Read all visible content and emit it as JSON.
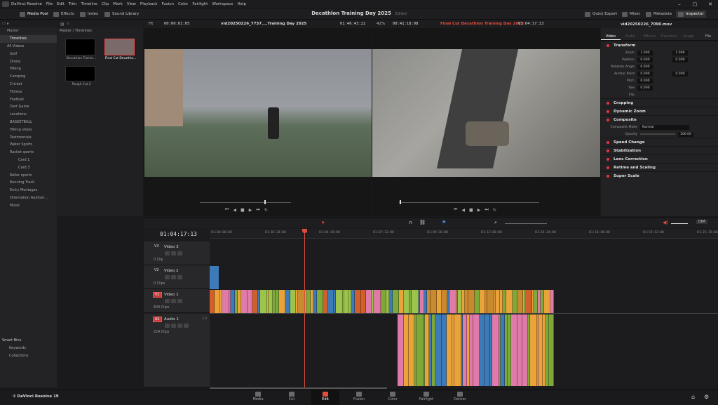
{
  "app": {
    "menu": [
      "DaVinci Resolve",
      "File",
      "Edit",
      "Trim",
      "Timeline",
      "Clip",
      "Mark",
      "View",
      "Playback",
      "Fusion",
      "Color",
      "Fairlight",
      "Workspace",
      "Help"
    ],
    "project_title": "Decathlon Training Day 2025",
    "edited_label": "Edited"
  },
  "toolbar": {
    "media_pool": "Media Pool",
    "effects": "Effects",
    "index": "Index",
    "sound_library": "Sound Library",
    "quick_export": "Quick Export",
    "mixer": "Mixer",
    "metadata": "Metadata",
    "inspector": "Inspector"
  },
  "bins": {
    "master": "Master",
    "items": [
      "Timelines",
      "All Videos",
      "Golf",
      "Drone",
      "Hiking",
      "Camping",
      "Cricket",
      "Fitness",
      "Football",
      "Dart Game",
      "Locations",
      "BASKETBALL",
      "Hiking shoes",
      "Testimonials",
      "Water Sports",
      "Racket sports",
      "Card 1",
      "Card 3",
      "Roller sports",
      "Running Track",
      "Entry Montages",
      "Orientation Auditori...",
      "Music"
    ],
    "smart_bins": "Smart Bins",
    "smart_items": [
      "Keywords",
      "Collections"
    ]
  },
  "pool": {
    "path": "Master / Timelines",
    "clips": [
      "Decathlon Trainin...",
      "Final Cut Decathlo...",
      "Rough Cut 2"
    ]
  },
  "source_viewer": {
    "fit": "Fit",
    "timecode_in": "00:00:01:05",
    "title": "vid20250226_7737....Training Day 2025",
    "timecode_out": "01:46:43:22"
  },
  "timeline_viewer": {
    "zoom": "42%",
    "timecode": "00:41:18:08",
    "title": "Final Cut Decathlon Training Day 2025",
    "timecode_out": "01:04:17:13"
  },
  "inspector": {
    "clip_name": "vid20250226_7090.mov",
    "tabs": [
      "Video",
      "Audio",
      "Effects",
      "Transition",
      "Image",
      "File"
    ],
    "transform": "Transform",
    "params": [
      {
        "label": "Zoom",
        "x": "1.000",
        "y": "1.000"
      },
      {
        "label": "Position",
        "x": "0.000",
        "y": "0.000"
      },
      {
        "label": "Rotation Angle",
        "x": "0.000",
        "y": ""
      },
      {
        "label": "Anchor Point",
        "x": "0.000",
        "y": "0.000"
      },
      {
        "label": "Pitch",
        "x": "0.000",
        "y": ""
      },
      {
        "label": "Yaw",
        "x": "0.000",
        "y": ""
      },
      {
        "label": "Flip",
        "x": "",
        "y": ""
      }
    ],
    "sections": [
      "Cropping",
      "Dynamic Zoom",
      "Composite"
    ],
    "composite_mode_label": "Composite Mode",
    "composite_mode": "Normal",
    "opacity_label": "Opacity",
    "opacity": "100.00",
    "more_sections": [
      "Speed Change",
      "Stabilization",
      "Lens Correction",
      "Retime and Scaling",
      "Super Scale"
    ]
  },
  "timeline": {
    "timecode": "01:04:17:13",
    "ruler": [
      "01:00:00:00",
      "01:02:24:00",
      "01:04:48:00",
      "01:07:12:00",
      "01:09:36:00",
      "01:12:00:00",
      "01:14:24:00",
      "01:16:48:00",
      "01:19:12:00",
      "01:21:36:00"
    ],
    "tracks": [
      {
        "id": "V3",
        "name": "Video 3",
        "clips": "0 Clip"
      },
      {
        "id": "V2",
        "name": "Video 2",
        "clips": "0 Clips"
      },
      {
        "id": "V1",
        "name": "Video 1",
        "clips": "600 Clips"
      },
      {
        "id": "A1",
        "name": "Audio 1",
        "clips": "224 Clips",
        "level": "2.0"
      }
    ],
    "dim": "DIM"
  },
  "pages": [
    "Media",
    "Cut",
    "Edit",
    "Fusion",
    "Color",
    "Fairlight",
    "Deliver"
  ],
  "footer": {
    "brand": "DaVinci Resolve 19"
  },
  "colors": {
    "accent": "#e64b3c",
    "playhead": "#e04b3b",
    "clip_blue": "#3d7ab8",
    "clip_orange": "#e9a33a",
    "clip_green": "#7ea83a",
    "clip_pink": "#e07aa8"
  }
}
